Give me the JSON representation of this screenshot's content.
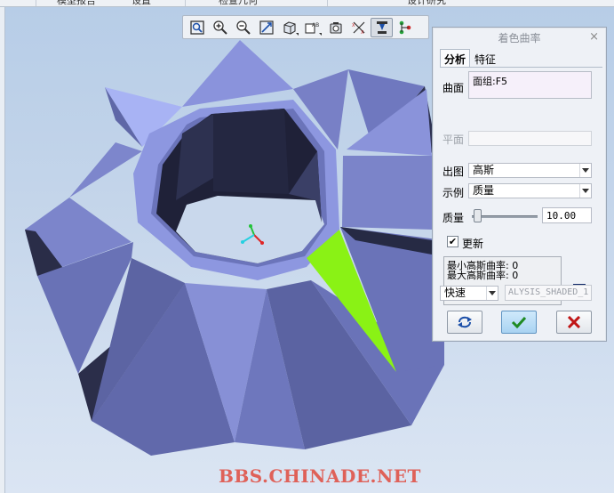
{
  "menu": {
    "items": [
      "模型报告",
      "设置",
      "检查几何",
      "设计研究"
    ]
  },
  "view_toolbar": {
    "buttons": [
      {
        "icon": "refit-icon",
        "active": false
      },
      {
        "icon": "zoom-in-icon",
        "active": false
      },
      {
        "icon": "zoom-out-icon",
        "active": false
      },
      {
        "icon": "reorient-icon",
        "active": false
      },
      {
        "icon": "display-style-icon",
        "active": false
      },
      {
        "icon": "annotation-display-icon",
        "active": false
      },
      {
        "icon": "spin-center-icon",
        "active": false
      },
      {
        "icon": "datum-display-icon",
        "active": false
      },
      {
        "icon": "model-tree-toggle-icon",
        "active": true
      },
      {
        "icon": "graph-icon",
        "active": false
      }
    ]
  },
  "dialog": {
    "title": "着色曲率",
    "close_label": "×",
    "tabs": [
      {
        "label": "分析",
        "active": true
      },
      {
        "label": "特征",
        "active": false
      }
    ],
    "surface_label": "曲面",
    "surface_value": "面组:F5",
    "plane_label": "平面",
    "plane_value": "",
    "output_label": "出图",
    "output_value": "高斯",
    "example_label": "示例",
    "example_value": "质量",
    "quality_label": "质量",
    "quality_value": "10.00",
    "quality_level": 0.0,
    "update_label": "更新",
    "update_checked": true,
    "result_text": "最小高斯曲率: 0\n最大高斯曲率: 0",
    "mode_value": "快速",
    "analysis_name": "ALYSIS_SHADED_1",
    "buttons": {
      "repeat": "repeat-icon",
      "ok": "checkmark-icon",
      "cancel": "cancel-x-icon"
    },
    "colors": {
      "ok_check": "#1f8a22",
      "cancel_x": "#c01515",
      "info_icon": "#1d3fa0"
    }
  },
  "model": {
    "colors": {
      "face_light": "#8d97e0",
      "face_mid": "#6f78bf",
      "face_dark": "#2a2d48",
      "highlight": "#8af215"
    }
  },
  "watermark": "BBS.CHINADE.NET"
}
